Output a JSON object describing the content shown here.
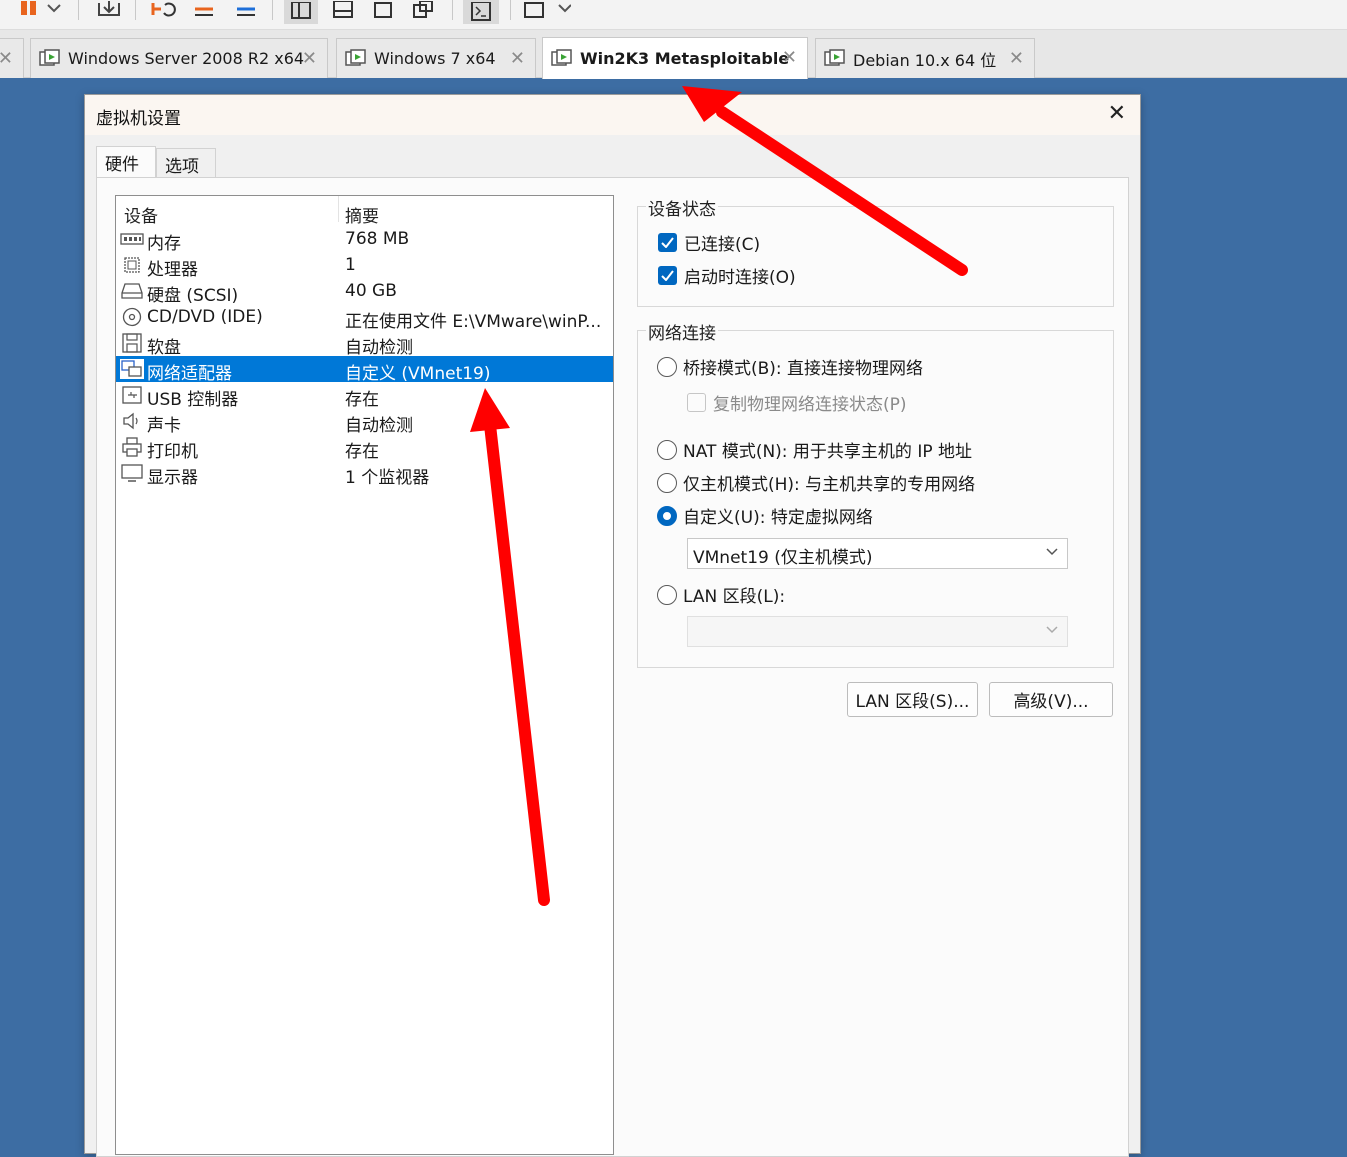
{
  "tabs": [
    {
      "label": "Windows Server 2008 R2 x64",
      "close": "✕",
      "active": false
    },
    {
      "label": "Windows 7 x64",
      "close": "✕",
      "active": false
    },
    {
      "label": "Win2K3 Metasploitable",
      "close": "✕",
      "active": true
    },
    {
      "label": "Debian 10.x 64 位",
      "close": "✕",
      "active": false
    }
  ],
  "dialog": {
    "title": "虚拟机设置",
    "close": "✕",
    "tabs": [
      "硬件",
      "选项"
    ]
  },
  "devices": {
    "headers": {
      "device": "设备",
      "summary": "摘要"
    },
    "rows": [
      {
        "icon": "memory-icon",
        "name": "内存",
        "summary": "768 MB"
      },
      {
        "icon": "processor-icon",
        "name": "处理器",
        "summary": "1"
      },
      {
        "icon": "harddisk-icon",
        "name": "硬盘 (SCSI)",
        "summary": "40 GB"
      },
      {
        "icon": "cd-dvd-icon",
        "name": "CD/DVD (IDE)",
        "summary": "正在使用文件 E:\\VMware\\winP..."
      },
      {
        "icon": "floppy-icon",
        "name": "软盘",
        "summary": "自动检测"
      },
      {
        "icon": "network-adapter-icon",
        "name": "网络适配器",
        "summary": "自定义 (VMnet19)"
      },
      {
        "icon": "usb-controller-icon",
        "name": "USB 控制器",
        "summary": "存在"
      },
      {
        "icon": "sound-card-icon",
        "name": "声卡",
        "summary": "自动检测"
      },
      {
        "icon": "printer-icon",
        "name": "打印机",
        "summary": "存在"
      },
      {
        "icon": "display-icon",
        "name": "显示器",
        "summary": "1 个监视器"
      }
    ],
    "selected_index": 5
  },
  "device_status": {
    "title": "设备状态",
    "connected": {
      "label": "已连接(C)",
      "checked": true
    },
    "connect_at_power_on": {
      "label": "启动时连接(O)",
      "checked": true
    }
  },
  "network": {
    "title": "网络连接",
    "bridged": {
      "label": "桥接模式(B): 直接连接物理网络",
      "selected": false
    },
    "replicate": {
      "label": "复制物理网络连接状态(P)",
      "checked": false
    },
    "nat": {
      "label": "NAT 模式(N): 用于共享主机的 IP 地址",
      "selected": false
    },
    "host_only": {
      "label": "仅主机模式(H): 与主机共享的专用网络",
      "selected": false
    },
    "custom": {
      "label": "自定义(U): 特定虚拟网络",
      "selected": true
    },
    "custom_value": "VMnet19 (仅主机模式)",
    "lan_segment": {
      "label": "LAN 区段(L):",
      "selected": false
    },
    "lan_value": ""
  },
  "buttons": {
    "lan_segments": "LAN 区段(S)...",
    "advanced": "高级(V)..."
  },
  "colors": {
    "desktop": "#3d6da3",
    "selection": "#0078d7",
    "checkbox": "#0067c0",
    "annotation_arrow": "#ff0000"
  }
}
